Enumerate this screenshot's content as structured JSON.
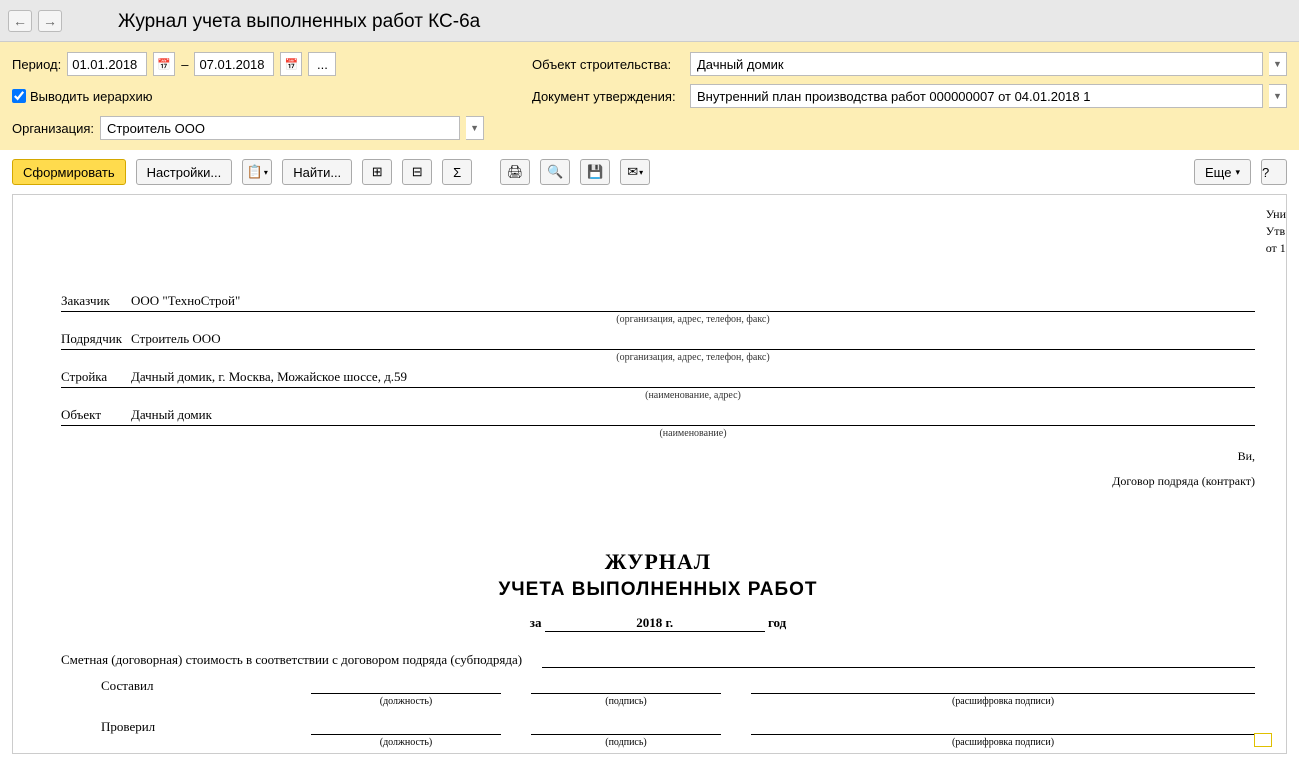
{
  "header": {
    "title": "Журнал учета выполненных работ КС-6а"
  },
  "params": {
    "period_label": "Период:",
    "date_from": "01.01.2018",
    "date_sep": "–",
    "date_to": "07.01.2018",
    "dots": "...",
    "hierarchy_label": "Выводить иерархию",
    "org_label": "Организация:",
    "org_value": "Строитель ООО",
    "object_label": "Объект строительства:",
    "object_value": "Дачный домик",
    "doc_label": "Документ утверждения:",
    "doc_value": "Внутренний план производства работ 000000007 от 04.01.2018 1"
  },
  "toolbar": {
    "generate": "Сформировать",
    "settings": "Настройки...",
    "find": "Найти...",
    "more": "Еще",
    "help": "?"
  },
  "report": {
    "top_right_1": "Уни",
    "top_right_2": "Утв",
    "top_right_3": "от 1",
    "customer_lbl": "Заказчик",
    "customer_val": "ООО \"ТехноСтрой\"",
    "contractor_lbl": "Подрядчик",
    "contractor_val": "Строитель ООО",
    "site_lbl": "Стройка",
    "site_val": "Дачный домик, г. Москва, Можайское шоссе, д.59",
    "object_lbl": "Объект",
    "object_val": "Дачный домик",
    "hint_org": "(организация, адрес, телефон, факс)",
    "hint_name_addr": "(наименование, адрес)",
    "hint_name": "(наименование)",
    "mid_right_1": "Ви,",
    "mid_right_2": "Договор подряда (контракт)",
    "title1": "ЖУРНАЛ",
    "title2": "УЧЕТА ВЫПОЛНЕННЫХ РАБОТ",
    "za": "за",
    "year_val": "2018 г.",
    "god": "год",
    "cost_label": "Сметная (договорная) стоимость в соответствии с договором подряда (субподряда)",
    "compiled_lbl": "Составил",
    "checked_lbl": "Проверил",
    "position_hint": "(должность)",
    "sign_hint": "(подпись)",
    "decrypt_hint": "(расшифровка подписи)"
  }
}
